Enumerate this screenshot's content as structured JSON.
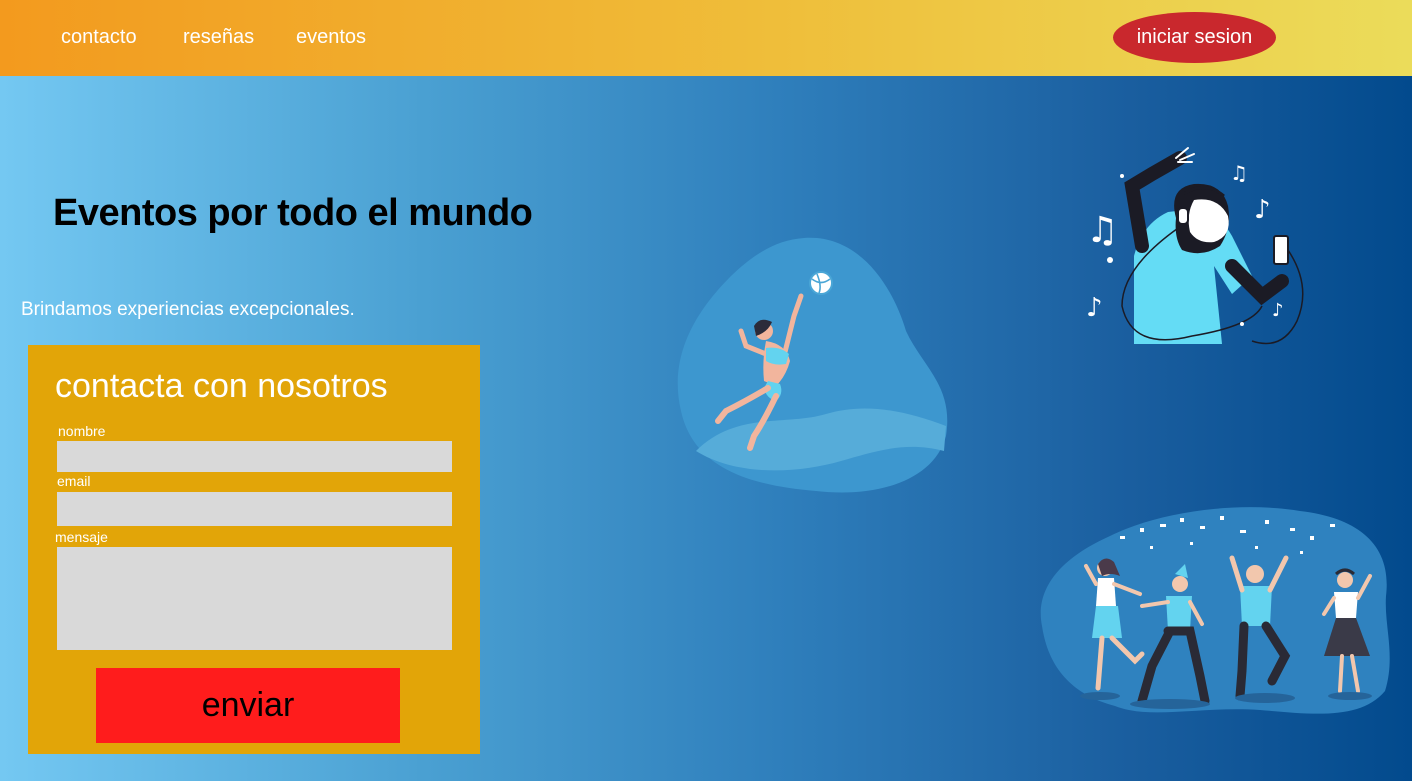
{
  "nav": {
    "links": [
      {
        "label": "contacto"
      },
      {
        "label": "reseñas"
      },
      {
        "label": "eventos"
      }
    ],
    "login_label": "iniciar sesion"
  },
  "hero": {
    "title": "Eventos por todo el mundo",
    "subtitle": "Brindamos experiencias excepcionales."
  },
  "contact_form": {
    "title": "contacta con nosotros",
    "fields": {
      "name_label": "nombre",
      "name_value": "",
      "email_label": "email",
      "email_value": "",
      "message_label": "mensaje",
      "message_value": ""
    },
    "submit_label": "enviar"
  },
  "illustrations": {
    "volleyball": "volleyball-player-illustration",
    "music": "music-listener-illustration",
    "party": "dancing-people-illustration"
  },
  "colors": {
    "topbar_start": "#f39a1e",
    "topbar_end": "#ebdc5a",
    "login_button": "#c9282d",
    "hero_start": "#74c8f2",
    "hero_end": "#024a8d",
    "card_background": "#e2a508",
    "input_background": "#d9d9d9",
    "submit_button": "#ff1c1c"
  }
}
